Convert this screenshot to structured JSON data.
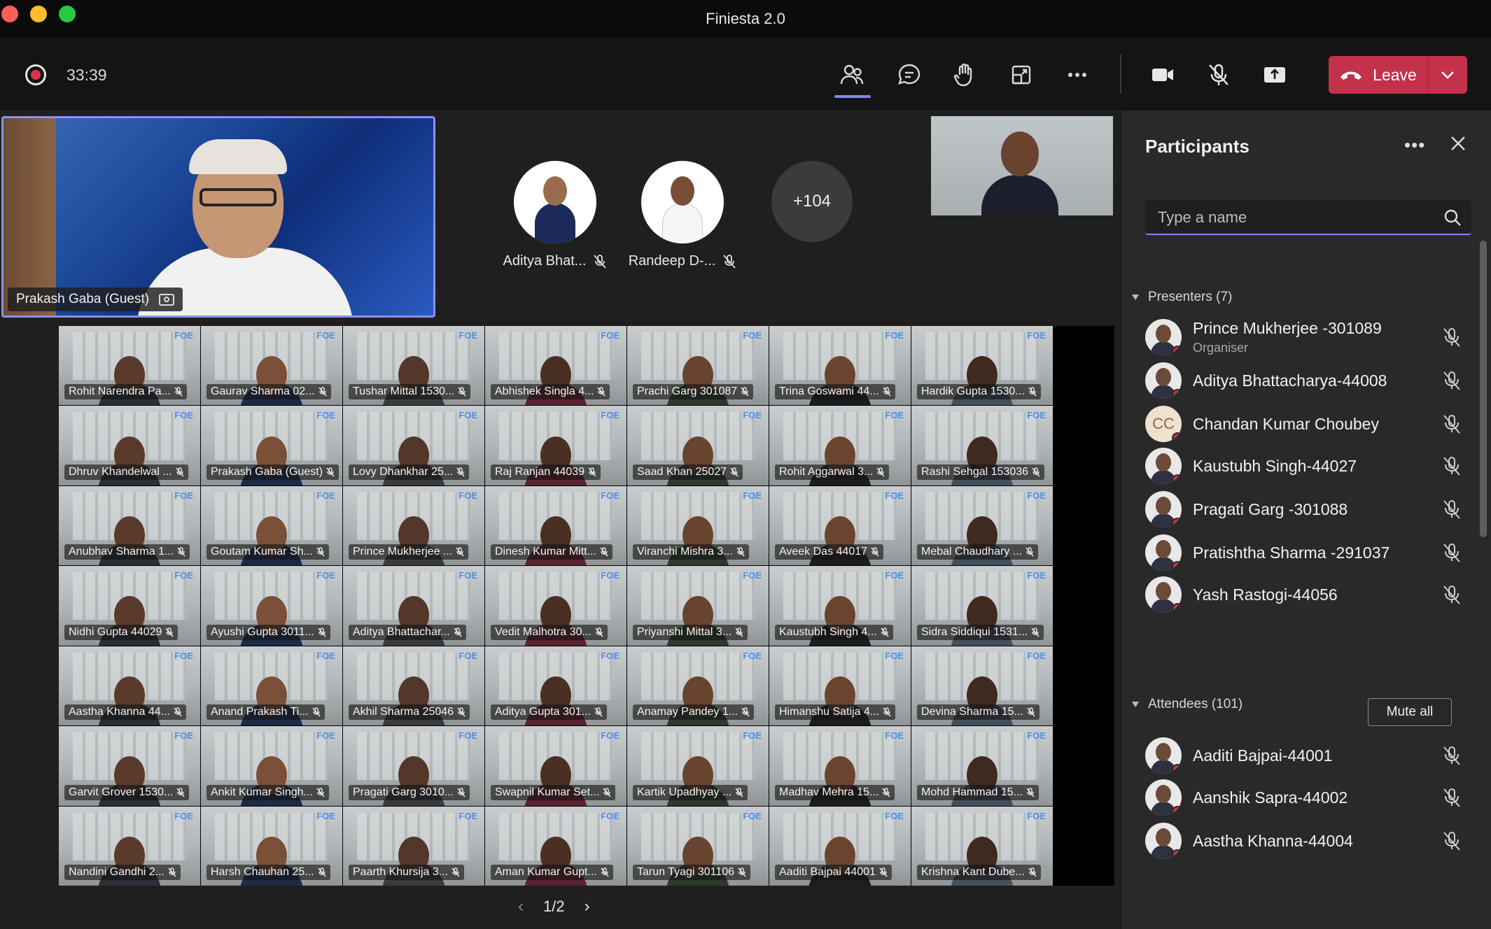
{
  "window": {
    "title": "Finiesta 2.0"
  },
  "toolbar": {
    "timer": "33:39",
    "leave_label": "Leave",
    "icons": [
      "participants-icon",
      "chat-icon",
      "raise-hand-icon",
      "room-icon",
      "more-icon",
      "camera-icon",
      "mic-off-icon",
      "share-icon"
    ]
  },
  "stage": {
    "speaker": {
      "name": "Prakash Gaba (Guest)"
    },
    "pinned": [
      {
        "name": "Aditya Bhat..."
      },
      {
        "name": "Randeep D-..."
      }
    ],
    "overflow": "+104",
    "pager": "1/2"
  },
  "grid": {
    "tiles": [
      "Rohit Narendra Pa...",
      "Gaurav Sharma 02...",
      "Tushar Mittal 1530...",
      "Abhishek Singla 4...",
      "Prachi Garg 301087",
      "Trina Goswami 44...",
      "Hardik Gupta 1530...",
      "Dhruv Khandelwal ...",
      "Prakash Gaba (Guest)",
      "Lovy Dhankhar 25...",
      "Raj Ranjan 44039",
      "Saad Khan 25027",
      "Rohit Aggarwal 3...",
      "Rashi Sehgal 153036",
      "Anubhav Sharma 1...",
      "Goutam Kumar Sh...",
      "Prince Mukherjee ...",
      "Dinesh Kumar Mitt...",
      "Viranchi Mishra 3...",
      "Aveek Das 44017",
      "Mebal Chaudhary ...",
      "Nidhi Gupta 44029",
      "Ayushi Gupta 3011...",
      "Aditya Bhattachar...",
      "Vedit Malhotra 30...",
      "Priyanshi Mittal 3...",
      "Kaustubh Singh 4...",
      "Sidra Siddiqui 1531...",
      "Aastha Khanna 44...",
      "Anand Prakash Ti...",
      "Akhil Sharma 25046",
      "Aditya Gupta 301...",
      "Anamay Pandey 1...",
      "Himanshu Satija 4...",
      "Devina Sharma 15...",
      "Garvit Grover 1530...",
      "Ankit Kumar Singh...",
      "Pragati Garg 3010...",
      "Swapnil Kumar Set...",
      "Kartik Upadhyay ...",
      "Madhav Mehra 15...",
      "Mohd Hammad 15...",
      "Nandini Gandhi 2...",
      "Harsh Chauhan 25...",
      "Paarth Khursija 3...",
      "Aman Kumar Gupt...",
      "Tarun Tyagi 301106",
      "Aaditi Bajpai 44001",
      "Krishna Kant Dube..."
    ],
    "logo_text": "FOE"
  },
  "panel": {
    "title": "Participants",
    "search_placeholder": "Type a name",
    "presenters_label": "Presenters (7)",
    "attendees_label": "Attendees (101)",
    "mute_all": "Mute all",
    "presenters": [
      {
        "name": "Prince Mukherjee -301089",
        "role": "Organiser"
      },
      {
        "name": "Aditya Bhattacharya-44008",
        "role": ""
      },
      {
        "name": "Chandan Kumar Choubey",
        "role": "",
        "initials": "CC"
      },
      {
        "name": "Kaustubh Singh-44027",
        "role": ""
      },
      {
        "name": "Pragati Garg -301088",
        "role": ""
      },
      {
        "name": "Pratishtha Sharma -291037",
        "role": ""
      },
      {
        "name": "Yash Rastogi-44056",
        "role": ""
      }
    ],
    "attendees": [
      {
        "name": "Aaditi Bajpai-44001"
      },
      {
        "name": "Aanshik Sapra-44002"
      },
      {
        "name": "Aastha Khanna-44004"
      }
    ]
  }
}
